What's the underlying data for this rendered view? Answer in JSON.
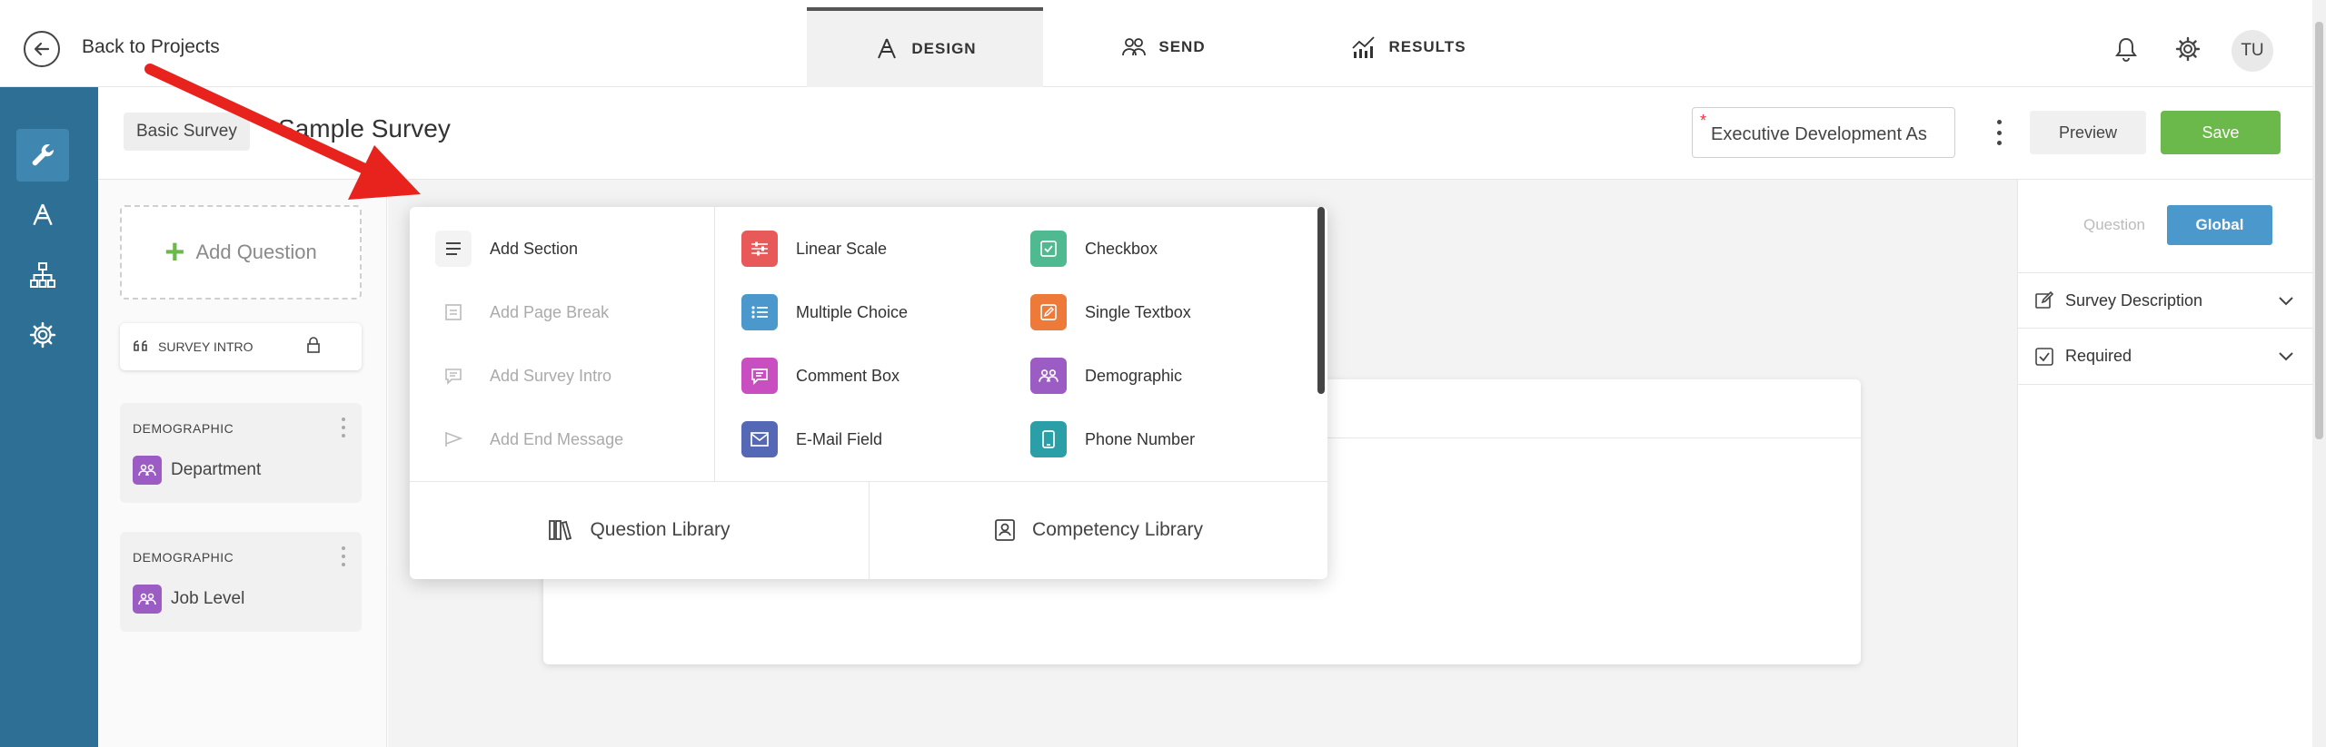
{
  "topbar": {
    "back_label": "Back to Projects",
    "tabs": [
      {
        "label": "DESIGN",
        "icon": "design-icon"
      },
      {
        "label": "SEND",
        "icon": "send-icon"
      },
      {
        "label": "RESULTS",
        "icon": "results-icon"
      }
    ],
    "avatar_initials": "TU"
  },
  "rail": {
    "items": [
      "wrench-icon",
      "design-icon",
      "hierarchy-icon",
      "gear-icon"
    ]
  },
  "header": {
    "survey_type": "Basic Survey",
    "title": "Sample Survey",
    "select_value": "Executive Development As",
    "preview_label": "Preview",
    "save_label": "Save"
  },
  "questions": {
    "add_label": "Add Question",
    "intro_label": "SURVEY INTRO",
    "items": [
      {
        "category": "DEMOGRAPHIC",
        "label": "Department"
      },
      {
        "category": "DEMOGRAPHIC",
        "label": "Job Level"
      }
    ]
  },
  "popup": {
    "actions": [
      {
        "label": "Add Section",
        "enabled": true
      },
      {
        "label": "Add Page Break",
        "enabled": false
      },
      {
        "label": "Add Survey Intro",
        "enabled": false
      },
      {
        "label": "Add End Message",
        "enabled": false
      }
    ],
    "types_col1": [
      {
        "label": "Linear Scale",
        "color": "#e85a5a"
      },
      {
        "label": "Multiple Choice",
        "color": "#4a98cc"
      },
      {
        "label": "Comment Box",
        "color": "#c94fc0"
      },
      {
        "label": "E-Mail Field",
        "color": "#5468b5"
      }
    ],
    "types_col2": [
      {
        "label": "Checkbox",
        "color": "#4fb98f"
      },
      {
        "label": "Single Textbox",
        "color": "#ee7a3a"
      },
      {
        "label": "Demographic",
        "color": "#9b5cc4"
      },
      {
        "label": "Phone Number",
        "color": "#2a9fa8"
      }
    ],
    "question_library": "Question Library",
    "competency_library": "Competency Library"
  },
  "right_panel": {
    "seg_question": "Question",
    "seg_global": "Global",
    "accordions": [
      "Survey Description",
      "Required"
    ]
  },
  "colors": {
    "rail": "#2e6f95",
    "save": "#6cb94b",
    "global": "#4a98cc",
    "arrow": "#e8231d"
  }
}
